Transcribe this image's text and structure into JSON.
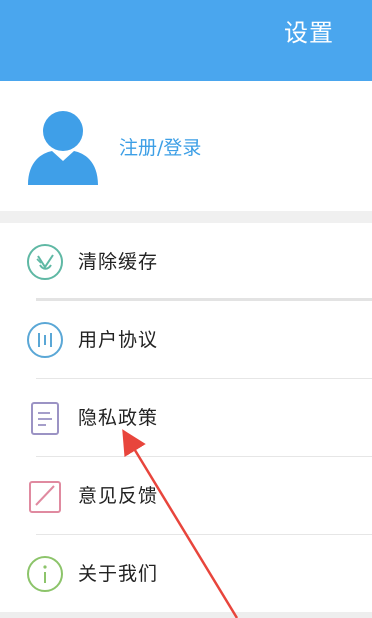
{
  "header": {
    "title": "设置"
  },
  "profile": {
    "login_label": "注册/登录",
    "avatar_icon": "user-avatar-icon"
  },
  "menu": {
    "items": [
      {
        "label": "清除缓存",
        "icon": "broom-icon",
        "color": "#5fb8a4"
      },
      {
        "label": "用户协议",
        "icon": "agreement-icon",
        "color": "#5aa7d6"
      },
      {
        "label": "隐私政策",
        "icon": "document-icon",
        "color": "#9b93c4"
      },
      {
        "label": "意见反馈",
        "icon": "edit-icon",
        "color": "#e08aa0"
      },
      {
        "label": "关于我们",
        "icon": "info-icon",
        "color": "#8cc46a"
      }
    ]
  },
  "annotation": {
    "color": "#e8453c"
  }
}
